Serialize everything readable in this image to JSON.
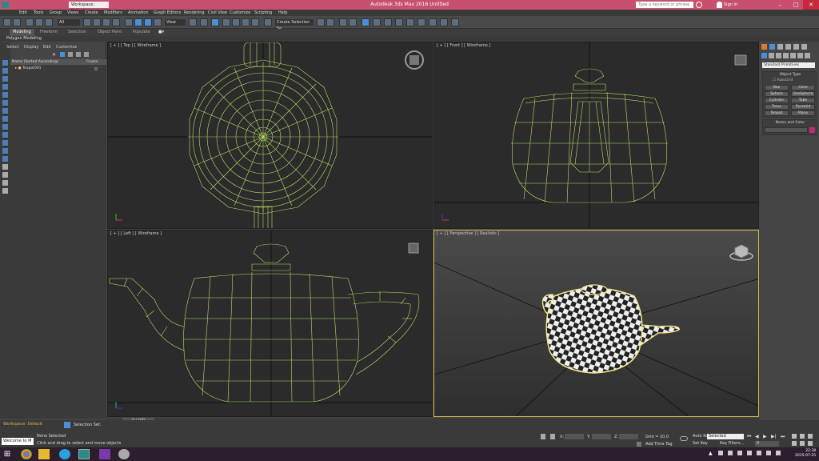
{
  "window": {
    "title": "Autodesk 3ds Max 2016    Untitled",
    "workspace": "Workspace: Default",
    "search_placeholder": "Type a keyword or phrase",
    "signin": "Sign In"
  },
  "menu": [
    "Edit",
    "Tools",
    "Group",
    "Views",
    "Create",
    "Modifiers",
    "Animation",
    "Graph Editors",
    "Rendering",
    "Civil View",
    "Customize",
    "Scripting",
    "Help"
  ],
  "toolbar": {
    "selection_filter": "All",
    "ref_coord": "View",
    "named_sel": "Create Selection Se"
  },
  "ribbon": {
    "tabs": [
      "Modeling",
      "Freeform",
      "Selection",
      "Object Paint",
      "Populate"
    ],
    "sub": "Polygon Modeling"
  },
  "scene_explorer": {
    "tabs": [
      "Select",
      "Display",
      "Edit",
      "Customize"
    ],
    "col_name": "Name (Sorted Ascending)",
    "col_frozen": "Frozen",
    "items": [
      "Teapot001"
    ]
  },
  "viewports": {
    "top": "[ + ] [ Top ] [ Wireframe ]",
    "front": "[ + ] [ Front ] [ Wireframe ]",
    "left": "[ + ] [ Left ] [ Wireframe ]",
    "perspective": "[ + ] [ Perspective ] [ Realistic ]"
  },
  "command_panel": {
    "category": "Standard Primitives",
    "object_type_title": "Object Type",
    "autogrid": "AutoGrid",
    "buttons": [
      "Box",
      "Cone",
      "Sphere",
      "GeoSphere",
      "Cylinder",
      "Tube",
      "Torus",
      "Pyramid",
      "Teapot",
      "Plane"
    ],
    "name_color_title": "Name and Color"
  },
  "timeline": {
    "frame": "0 / 100",
    "ticks": [
      "0",
      "5",
      "10",
      "15",
      "20",
      "25",
      "30",
      "35",
      "40",
      "45",
      "50",
      "55",
      "60",
      "65",
      "70",
      "75",
      "80",
      "85",
      "90",
      "95",
      "100"
    ]
  },
  "status": {
    "workspace": "Workspace: Default",
    "selection_set": "Selection Set:",
    "maxscript": "Welcome to M",
    "none_selected": "None Selected",
    "prompt": "Click and drag to select and move objects",
    "grid": "Grid = 10.0",
    "add_time_tag": "Add Time Tag",
    "auto_key": "Auto Key",
    "selected": "Selected",
    "set_key": "Set Key",
    "key_filters": "Key Filters...",
    "x_label": "X:",
    "y_label": "Y:",
    "z_label": "Z:",
    "frame_num": "0"
  },
  "taskbar": {
    "time": "22:38",
    "date": "2015-07-25"
  },
  "colors": {
    "titlebar": "#c8506e",
    "wire": "#b8e06a",
    "selected_wire": "#e8e888",
    "active_vp": "#d4b84a",
    "taskbar": "#2d1e2e"
  }
}
